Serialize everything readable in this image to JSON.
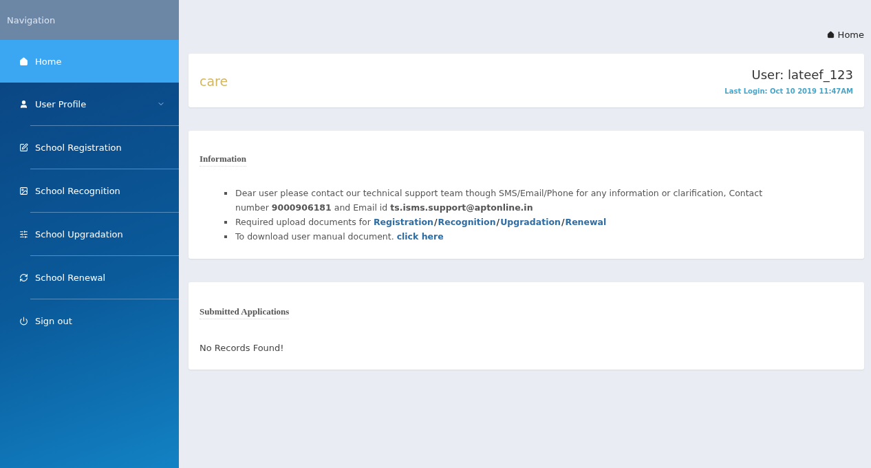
{
  "sidebar": {
    "header": "Navigation",
    "items": [
      {
        "label": "Home",
        "selected": true
      },
      {
        "label": "User Profile",
        "selected": false,
        "expanded": false
      },
      {
        "label": "School Registration",
        "selected": false
      },
      {
        "label": "School Recognition",
        "selected": false
      },
      {
        "label": "School Upgradation",
        "selected": false
      },
      {
        "label": "School Renewal",
        "selected": false
      },
      {
        "label": "Sign out",
        "selected": false
      }
    ]
  },
  "breadcrumb": "Home",
  "header_card": {
    "title": "care",
    "user": "User: lateef_123",
    "last_login": "Last Login: Oct 10 2019 11:47AM"
  },
  "information": {
    "title": "Information",
    "bullets": [
      [
        {
          "kind": "text",
          "text": "Dear user please contact our technical support team though SMS/Email/Phone for any information or clarification, Contact number **9000906181** and Email id **ts.isms.support@aptonline.in**"
        }
      ],
      [
        {
          "kind": "text",
          "text": "Required upload documents for"
        },
        {
          "kind": "link",
          "text": "Registration"
        },
        {
          "kind": "sep",
          "text": "/"
        },
        {
          "kind": "link",
          "text": "Recognition"
        },
        {
          "kind": "sep",
          "text": "/"
        },
        {
          "kind": "link",
          "text": "Upgradation"
        },
        {
          "kind": "sep",
          "text": "/"
        },
        {
          "kind": "link",
          "text": "Renewal"
        }
      ],
      [
        {
          "kind": "text",
          "text": "To download user manual document."
        },
        {
          "kind": "link",
          "text": "click here"
        }
      ]
    ]
  },
  "submitted": {
    "title": "Submitted Applications",
    "message": "No Records Found!"
  }
}
